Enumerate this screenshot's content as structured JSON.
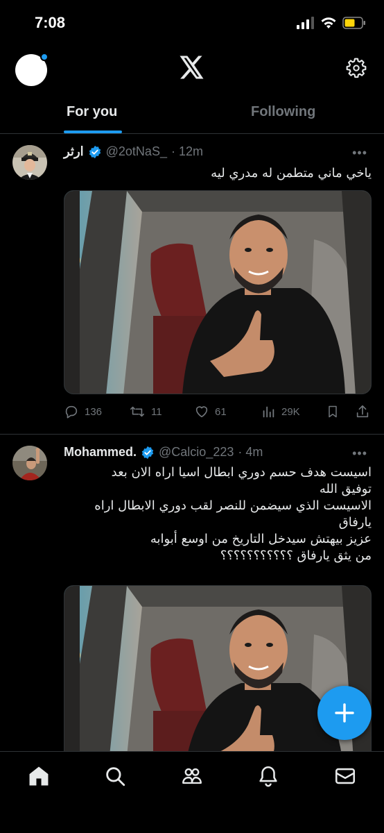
{
  "status_bar": {
    "time": "7:08"
  },
  "tabs": [
    {
      "label": "For you"
    },
    {
      "label": "Following"
    }
  ],
  "tweets": [
    {
      "name": "ارثر",
      "handle": "@2otNaS_",
      "time": "· 12m",
      "text_lines": [
        "ياخي ماني متطمن له مدري ليه"
      ],
      "stats": {
        "replies": "136",
        "reposts": "11",
        "likes": "61",
        "views": "29K"
      }
    },
    {
      "name": "Mohammed.",
      "handle": "@Calcio_223",
      "time": "· 4m",
      "text_lines": [
        "اسيست هدف حسم دوري ابطال اسيا اراه الان بعد",
        "توفيق الله",
        "الاسيست الذي سيضمن للنصر لقب دوري الابطال اراه",
        "يارفاق",
        "عزيز بيهتش سيدخل التاريخ من اوسع أبوابه",
        "من يثق يارفاق ؟؟؟؟؟؟؟؟؟؟؟"
      ]
    }
  ],
  "colors": {
    "accent": "#1d9bf0",
    "background": "#000000",
    "muted": "#71767b",
    "text": "#e7e9ea"
  },
  "icons": [
    "x-logo-icon",
    "gear-icon",
    "verified-badge-icon",
    "reply-icon",
    "repost-icon",
    "like-icon",
    "views-icon",
    "bookmark-icon",
    "share-icon",
    "plus-icon",
    "home-icon",
    "search-icon",
    "communities-icon",
    "bell-icon",
    "mail-icon"
  ]
}
